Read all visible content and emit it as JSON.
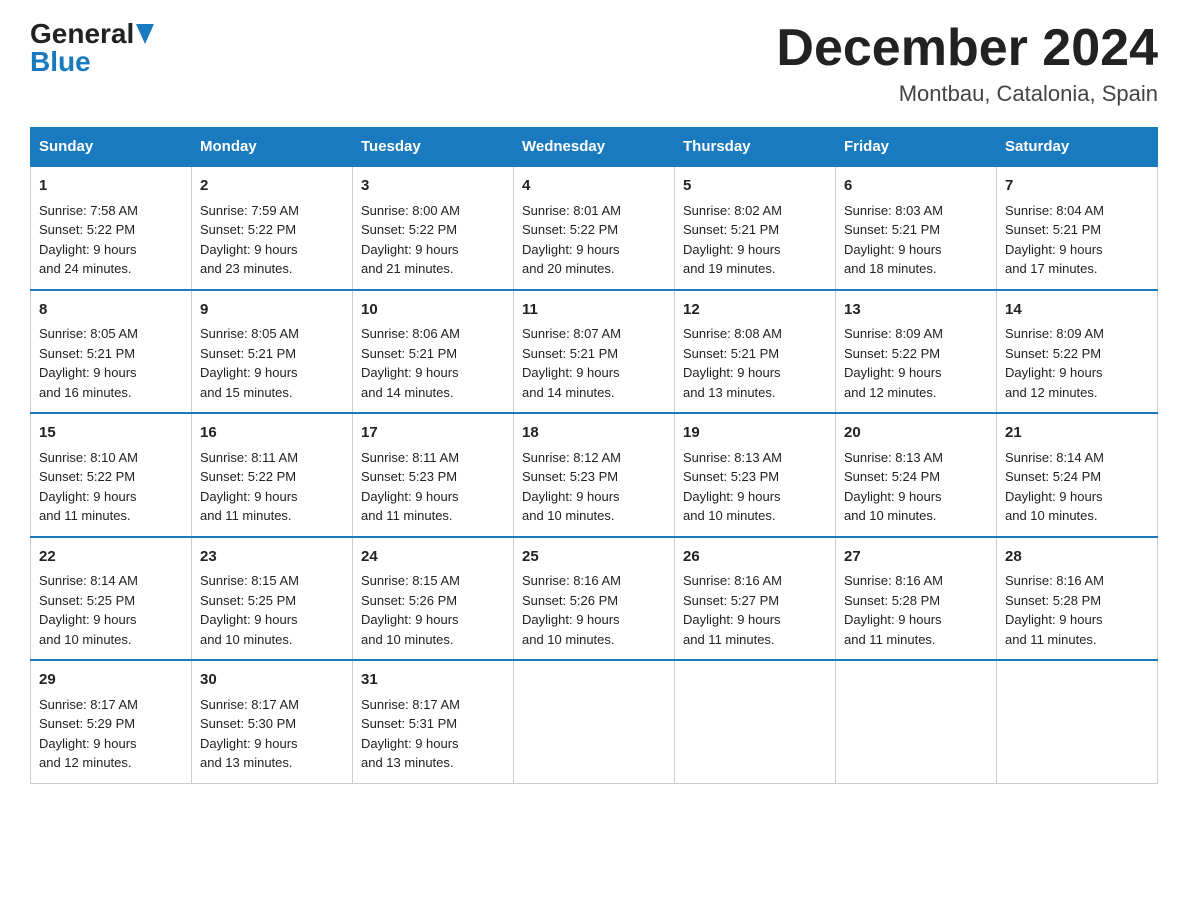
{
  "header": {
    "logo_general": "General",
    "logo_blue": "Blue",
    "month_year": "December 2024",
    "location": "Montbau, Catalonia, Spain"
  },
  "days_of_week": [
    "Sunday",
    "Monday",
    "Tuesday",
    "Wednesday",
    "Thursday",
    "Friday",
    "Saturday"
  ],
  "weeks": [
    [
      {
        "day": "1",
        "sunrise": "7:58 AM",
        "sunset": "5:22 PM",
        "daylight": "9 hours and 24 minutes."
      },
      {
        "day": "2",
        "sunrise": "7:59 AM",
        "sunset": "5:22 PM",
        "daylight": "9 hours and 23 minutes."
      },
      {
        "day": "3",
        "sunrise": "8:00 AM",
        "sunset": "5:22 PM",
        "daylight": "9 hours and 21 minutes."
      },
      {
        "day": "4",
        "sunrise": "8:01 AM",
        "sunset": "5:22 PM",
        "daylight": "9 hours and 20 minutes."
      },
      {
        "day": "5",
        "sunrise": "8:02 AM",
        "sunset": "5:21 PM",
        "daylight": "9 hours and 19 minutes."
      },
      {
        "day": "6",
        "sunrise": "8:03 AM",
        "sunset": "5:21 PM",
        "daylight": "9 hours and 18 minutes."
      },
      {
        "day": "7",
        "sunrise": "8:04 AM",
        "sunset": "5:21 PM",
        "daylight": "9 hours and 17 minutes."
      }
    ],
    [
      {
        "day": "8",
        "sunrise": "8:05 AM",
        "sunset": "5:21 PM",
        "daylight": "9 hours and 16 minutes."
      },
      {
        "day": "9",
        "sunrise": "8:05 AM",
        "sunset": "5:21 PM",
        "daylight": "9 hours and 15 minutes."
      },
      {
        "day": "10",
        "sunrise": "8:06 AM",
        "sunset": "5:21 PM",
        "daylight": "9 hours and 14 minutes."
      },
      {
        "day": "11",
        "sunrise": "8:07 AM",
        "sunset": "5:21 PM",
        "daylight": "9 hours and 14 minutes."
      },
      {
        "day": "12",
        "sunrise": "8:08 AM",
        "sunset": "5:21 PM",
        "daylight": "9 hours and 13 minutes."
      },
      {
        "day": "13",
        "sunrise": "8:09 AM",
        "sunset": "5:22 PM",
        "daylight": "9 hours and 12 minutes."
      },
      {
        "day": "14",
        "sunrise": "8:09 AM",
        "sunset": "5:22 PM",
        "daylight": "9 hours and 12 minutes."
      }
    ],
    [
      {
        "day": "15",
        "sunrise": "8:10 AM",
        "sunset": "5:22 PM",
        "daylight": "9 hours and 11 minutes."
      },
      {
        "day": "16",
        "sunrise": "8:11 AM",
        "sunset": "5:22 PM",
        "daylight": "9 hours and 11 minutes."
      },
      {
        "day": "17",
        "sunrise": "8:11 AM",
        "sunset": "5:23 PM",
        "daylight": "9 hours and 11 minutes."
      },
      {
        "day": "18",
        "sunrise": "8:12 AM",
        "sunset": "5:23 PM",
        "daylight": "9 hours and 10 minutes."
      },
      {
        "day": "19",
        "sunrise": "8:13 AM",
        "sunset": "5:23 PM",
        "daylight": "9 hours and 10 minutes."
      },
      {
        "day": "20",
        "sunrise": "8:13 AM",
        "sunset": "5:24 PM",
        "daylight": "9 hours and 10 minutes."
      },
      {
        "day": "21",
        "sunrise": "8:14 AM",
        "sunset": "5:24 PM",
        "daylight": "9 hours and 10 minutes."
      }
    ],
    [
      {
        "day": "22",
        "sunrise": "8:14 AM",
        "sunset": "5:25 PM",
        "daylight": "9 hours and 10 minutes."
      },
      {
        "day": "23",
        "sunrise": "8:15 AM",
        "sunset": "5:25 PM",
        "daylight": "9 hours and 10 minutes."
      },
      {
        "day": "24",
        "sunrise": "8:15 AM",
        "sunset": "5:26 PM",
        "daylight": "9 hours and 10 minutes."
      },
      {
        "day": "25",
        "sunrise": "8:16 AM",
        "sunset": "5:26 PM",
        "daylight": "9 hours and 10 minutes."
      },
      {
        "day": "26",
        "sunrise": "8:16 AM",
        "sunset": "5:27 PM",
        "daylight": "9 hours and 11 minutes."
      },
      {
        "day": "27",
        "sunrise": "8:16 AM",
        "sunset": "5:28 PM",
        "daylight": "9 hours and 11 minutes."
      },
      {
        "day": "28",
        "sunrise": "8:16 AM",
        "sunset": "5:28 PM",
        "daylight": "9 hours and 11 minutes."
      }
    ],
    [
      {
        "day": "29",
        "sunrise": "8:17 AM",
        "sunset": "5:29 PM",
        "daylight": "9 hours and 12 minutes."
      },
      {
        "day": "30",
        "sunrise": "8:17 AM",
        "sunset": "5:30 PM",
        "daylight": "9 hours and 13 minutes."
      },
      {
        "day": "31",
        "sunrise": "8:17 AM",
        "sunset": "5:31 PM",
        "daylight": "9 hours and 13 minutes."
      },
      null,
      null,
      null,
      null
    ]
  ],
  "labels": {
    "sunrise": "Sunrise:",
    "sunset": "Sunset:",
    "daylight": "Daylight:"
  }
}
